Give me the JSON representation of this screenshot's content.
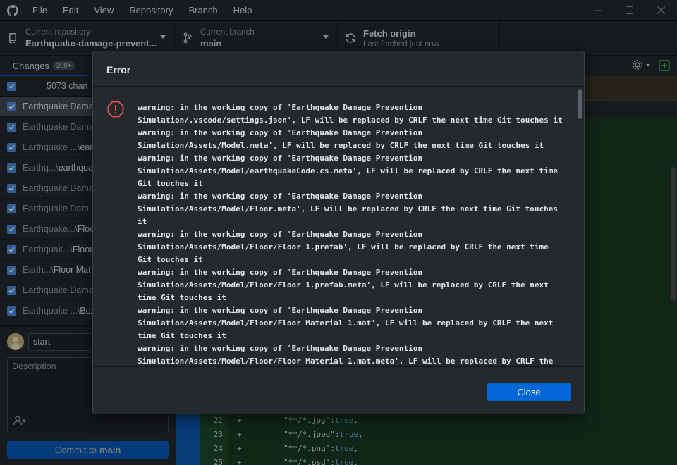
{
  "menu": [
    "File",
    "Edit",
    "View",
    "Repository",
    "Branch",
    "Help"
  ],
  "toolbar": {
    "repo_label": "Current repository",
    "repo_value": "Earthquake-damage-prevent...",
    "branch_label": "Current branch",
    "branch_value": "main",
    "fetch_label": "Fetch origin",
    "fetch_sub": "Last fetched just now"
  },
  "sidebar": {
    "tab_changes": "Changes",
    "tab_changes_badge": "300+",
    "header_text": "5073 chan",
    "files": [
      {
        "dim": "",
        "bright": "Earthquake Dama..."
      },
      {
        "dim": "Earthquake Damag",
        "bright": ""
      },
      {
        "dim": "Earthquake ...\\",
        "bright": "ear"
      },
      {
        "dim": "Earthq...\\",
        "bright": "earthqua"
      },
      {
        "dim": "Earthquake Damag",
        "bright": ""
      },
      {
        "dim": "Earthquake Dam...",
        "bright": ""
      },
      {
        "dim": "Earthquake...\\",
        "bright": "Floo"
      },
      {
        "dim": "Earthquak...\\",
        "bright": "Floor"
      },
      {
        "dim": "Earth...\\",
        "bright": "Floor Mat"
      },
      {
        "dim": "Earthquake Damag",
        "bright": ""
      },
      {
        "dim": "Earthquake ...\\",
        "bright": "Box"
      }
    ],
    "summary_value": "start",
    "description_placeholder": "Description",
    "commit_prefix": "Commit to",
    "commit_branch": "main"
  },
  "diff": {
    "lines": [
      {
        "num": "22",
        "sign": "+",
        "str": "\"**/*.jpg\"",
        "val": "true"
      },
      {
        "num": "23",
        "sign": "+",
        "str": "\"**/*.jpeg\"",
        "val": "true"
      },
      {
        "num": "24",
        "sign": "+",
        "str": "\"**/*.png\"",
        "val": "true"
      },
      {
        "num": "25",
        "sign": "+",
        "str": "\"**/*.psd\"",
        "val": "true"
      }
    ]
  },
  "dialog": {
    "title": "Error",
    "message": "warning: in the working copy of 'Earthquake Damage Prevention\nSimulation/.vscode/settings.json', LF will be replaced by CRLF the next time Git touches it\nwarning: in the working copy of 'Earthquake Damage Prevention\nSimulation/Assets/Model.meta', LF will be replaced by CRLF the next time Git touches it\nwarning: in the working copy of 'Earthquake Damage Prevention\nSimulation/Assets/Model/earthquakeCode.cs.meta', LF will be replaced by CRLF the next time\nGit touches it\nwarning: in the working copy of 'Earthquake Damage Prevention\nSimulation/Assets/Model/Floor.meta', LF will be replaced by CRLF the next time Git touches\nit\nwarning: in the working copy of 'Earthquake Damage Prevention\nSimulation/Assets/Model/Floor/Floor 1.prefab', LF will be replaced by CRLF the next time\nGit touches it\nwarning: in the working copy of 'Earthquake Damage Prevention\nSimulation/Assets/Model/Floor/Floor 1.prefab.meta', LF will be replaced by CRLF the next\ntime Git touches it\nwarning: in the working copy of 'Earthquake Damage Prevention\nSimulation/Assets/Model/Floor/Floor Material 1.mat', LF will be replaced by CRLF the next\ntime Git touches it\nwarning: in the working copy of 'Earthquake Damage Prevention\nSimulation/Assets/Model/Floor/Floor Material 1.mat.meta', LF will be replaced by CRLF the",
    "close_label": "Close"
  }
}
